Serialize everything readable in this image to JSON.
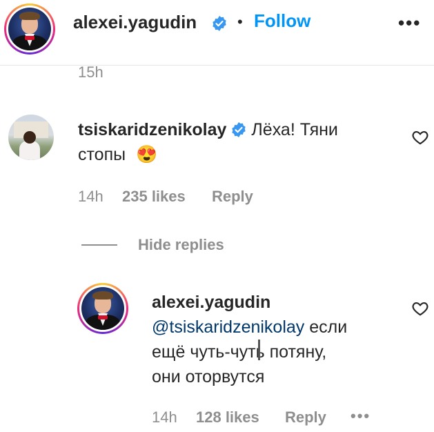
{
  "header": {
    "username": "alexei.yagudin",
    "separator": "•",
    "follow_label": "Follow",
    "more_label": "•••"
  },
  "previous_comment": {
    "time": "15h"
  },
  "comment": {
    "username": "tsiskaridzenikolay",
    "text": "Лёха! Тяни",
    "text_line2": "стопы",
    "emoji": "😍",
    "time": "14h",
    "likes": "235 likes",
    "reply_label": "Reply"
  },
  "hide_replies_label": "Hide replies",
  "reply": {
    "username": "alexei.yagudin",
    "mention": "@tsiskaridzenikolay",
    "text_line1_rest": " если",
    "text_line2": "ещё чуть-чуть потяну,",
    "text_line3": "они оторвутся",
    "time": "14h",
    "likes": "128 likes",
    "reply_label": "Reply",
    "more_label": "•••"
  },
  "colors": {
    "follow_blue": "#0095f6",
    "verified_blue": "#3897f0",
    "meta_gray": "#8e8e8e",
    "mention_navy": "#00376b"
  },
  "icons": [
    "verified-icon",
    "heart-icon",
    "more-icon"
  ]
}
